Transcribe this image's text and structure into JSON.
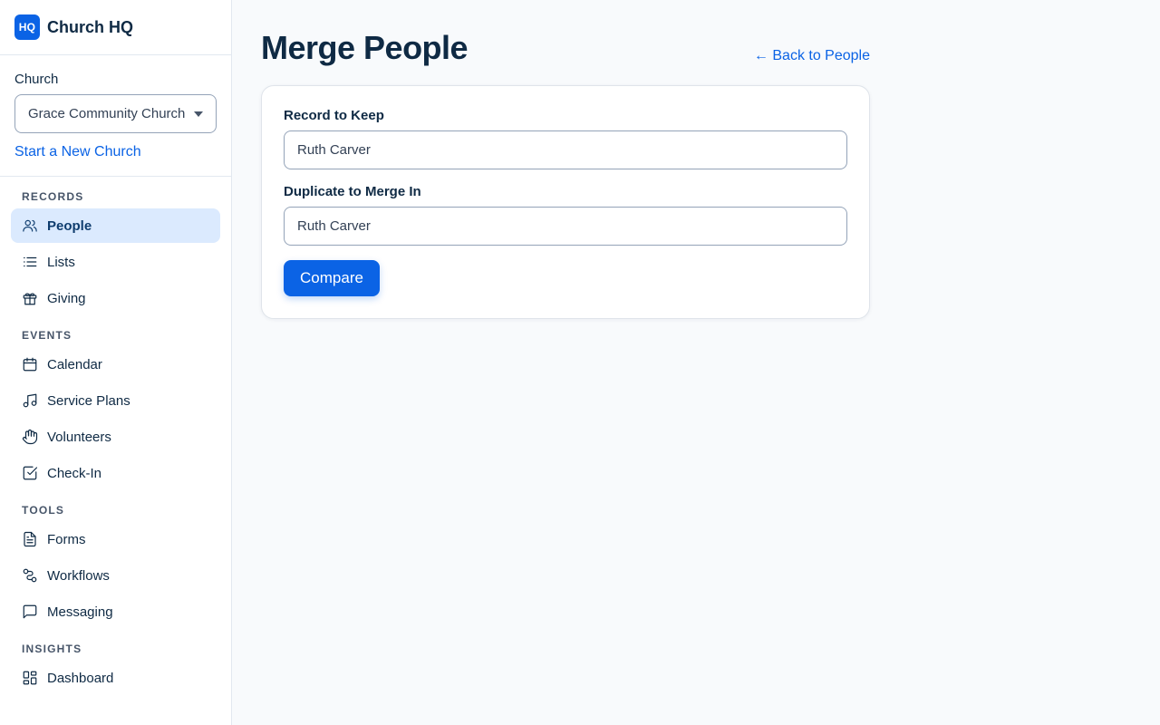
{
  "brand": {
    "logo_text": "HQ",
    "name": "Church HQ"
  },
  "church": {
    "label": "Church",
    "selected": "Grace Community Church",
    "new_church_link": "Start a New Church"
  },
  "nav": {
    "records": {
      "heading": "RECORDS",
      "items": [
        {
          "label": "People",
          "icon": "users-icon",
          "active": true
        },
        {
          "label": "Lists",
          "icon": "list-icon"
        },
        {
          "label": "Giving",
          "icon": "gift-icon"
        }
      ]
    },
    "events": {
      "heading": "EVENTS",
      "items": [
        {
          "label": "Calendar",
          "icon": "calendar-icon"
        },
        {
          "label": "Service Plans",
          "icon": "music-note-icon"
        },
        {
          "label": "Volunteers",
          "icon": "hand-icon"
        },
        {
          "label": "Check-In",
          "icon": "checkbox-icon"
        }
      ]
    },
    "tools": {
      "heading": "TOOLS",
      "items": [
        {
          "label": "Forms",
          "icon": "document-icon"
        },
        {
          "label": "Workflows",
          "icon": "workflow-icon"
        },
        {
          "label": "Messaging",
          "icon": "message-icon"
        }
      ]
    },
    "insights": {
      "heading": "INSIGHTS",
      "items": [
        {
          "label": "Dashboard",
          "icon": "dashboard-icon"
        }
      ]
    }
  },
  "page": {
    "title": "Merge People",
    "back_link": "← Back to People"
  },
  "form": {
    "keep_label": "Record to Keep",
    "keep_value": "Ruth Carver",
    "duplicate_label": "Duplicate to Merge In",
    "duplicate_value": "Ruth Carver",
    "compare_label": "Compare"
  },
  "colors": {
    "accent": "#0b63e5",
    "active_nav_bg": "#dbeafe",
    "text": "#0f2a44"
  }
}
